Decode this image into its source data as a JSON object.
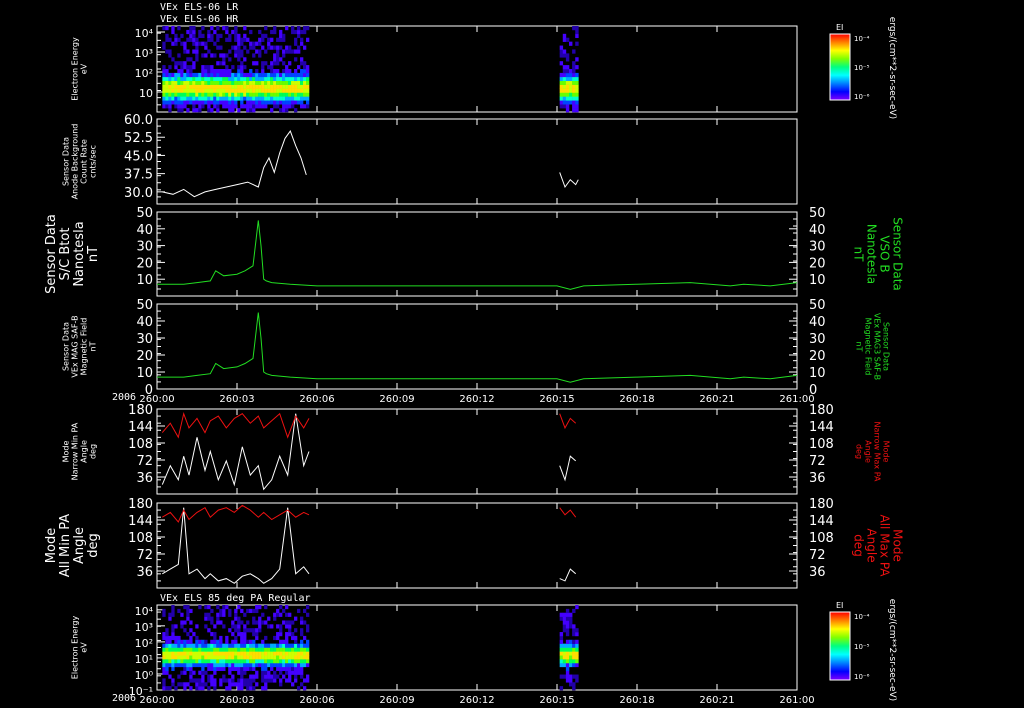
{
  "header": {
    "line1": "VEx ELS-06 LR",
    "line2": "VEx ELS-06 HR",
    "bottom_title": "VEx ELS 85 deg PA Regular",
    "year_mid": "2006",
    "year_bottom": "2006"
  },
  "colorbar": {
    "label": "EI",
    "units": "ergs/(cm**2-sr-sec-eV)",
    "ticks": [
      "10⁻⁴",
      "10⁻⁵",
      "10⁻⁶"
    ],
    "colors": [
      "#ff0000",
      "#ff8000",
      "#ffff00",
      "#80ff00",
      "#00ff80",
      "#00ffff",
      "#0080ff",
      "#0000ff",
      "#8000ff"
    ]
  },
  "colors": {
    "frame": "#ffffff",
    "green": "#22dd22",
    "red": "#ee1111",
    "white": "#ffffff"
  },
  "chart_data": {
    "type": "line",
    "x_tick_labels": [
      "260:00",
      "260:03",
      "260:06",
      "260:09",
      "260:12",
      "260:15",
      "260:18",
      "260:21",
      "261:00"
    ],
    "xlim_hours": [
      0,
      24
    ],
    "panels": [
      {
        "id": "els-spectrogram-top",
        "type": "heatmap",
        "ylabel_lines": [
          "Electron Energy",
          "eV"
        ],
        "y_tick_labels": [
          "10⁴",
          "10³",
          "10²",
          "10"
        ],
        "ylim_log10": [
          0,
          4.3
        ],
        "data_intervals_hours": [
          [
            0.2,
            5.7
          ],
          [
            15.1,
            15.8
          ]
        ]
      },
      {
        "id": "anode-background",
        "ylabel_lines": [
          "Sensor Data",
          "Anode Background",
          "Count Rate",
          "cnts/sec"
        ],
        "y_tick_labels": [
          "60.0",
          "52.5",
          "45.0",
          "37.5",
          "30.0"
        ],
        "ylim": [
          25,
          60
        ],
        "series": [
          {
            "color": "white",
            "x": [
              0.2,
              0.6,
              1.0,
              1.4,
              1.8,
              2.2,
              2.6,
              3.0,
              3.4,
              3.8,
              4.0,
              4.2,
              4.4,
              4.6,
              4.8,
              5.0,
              5.2,
              5.4,
              5.6,
              15.1,
              15.3,
              15.5,
              15.7,
              15.8
            ],
            "y": [
              30,
              29,
              31,
              28,
              30,
              31,
              32,
              33,
              34,
              32,
              40,
              44,
              38,
              46,
              52,
              55,
              49,
              44,
              37,
              38,
              32,
              35,
              33,
              35
            ]
          }
        ]
      },
      {
        "id": "sc-bmag",
        "ylabel_lines": [
          "Sensor Data",
          "S/C Btot",
          "Nanotesla",
          "nT"
        ],
        "ylabel_right_lines": [
          "Sensor Data",
          "VSO B",
          "Nanotesla",
          "nT"
        ],
        "y_tick_labels": [
          "50",
          "40",
          "30",
          "20",
          "10"
        ],
        "ylim": [
          0,
          50
        ],
        "series": [
          {
            "color": "green",
            "x": [
              0,
              1,
              1.5,
              2,
              2.2,
              2.5,
              3,
              3.3,
              3.6,
              3.8,
              3.9,
              4.0,
              4.1,
              4.3,
              5,
              6,
              8,
              10,
              12,
              14,
              15,
              15.5,
              16,
              18,
              20,
              21.5,
              22,
              23,
              24
            ],
            "y": [
              7,
              7,
              8,
              9,
              15,
              12,
              13,
              15,
              18,
              45,
              30,
              10,
              9,
              8,
              7,
              6,
              6,
              6,
              6,
              6,
              6,
              4,
              6,
              7,
              8,
              6,
              7,
              6,
              8
            ]
          }
        ]
      },
      {
        "id": "mag-field",
        "ylabel_lines": [
          "Sensor Data",
          "VEx MAG SAF-B",
          "Magnetic Field",
          "nT"
        ],
        "ylabel_right_lines": [
          "Sensor Data",
          "VEx MAG3 SAF-B",
          "Magnetic Field",
          "nT"
        ],
        "y_tick_labels": [
          "50",
          "40",
          "30",
          "20",
          "10",
          "0"
        ],
        "ylim": [
          0,
          50
        ],
        "series": [
          {
            "color": "green",
            "x": [
              0,
              1,
              1.5,
              2,
              2.2,
              2.5,
              3,
              3.3,
              3.6,
              3.8,
              3.9,
              4.0,
              4.1,
              4.3,
              5,
              6,
              8,
              10,
              12,
              14,
              15,
              15.5,
              16,
              18,
              20,
              21.5,
              22,
              23,
              24
            ],
            "y": [
              7,
              7,
              8,
              9,
              15,
              12,
              13,
              15,
              18,
              45,
              30,
              10,
              9,
              8,
              7,
              6,
              6,
              6,
              6,
              6,
              6,
              4,
              6,
              7,
              8,
              6,
              7,
              6,
              8
            ]
          }
        ]
      },
      {
        "id": "narrow-pa",
        "ylabel_lines": [
          "Mode",
          "Narrow Min PA",
          "Angle",
          "deg"
        ],
        "ylabel_right_lines": [
          "Mode",
          "Narrow Max PA",
          "Angle",
          "deg"
        ],
        "y_tick_labels": [
          "180",
          "144",
          "108",
          "72",
          "36"
        ],
        "ylim": [
          0,
          180
        ],
        "series": [
          {
            "color": "white",
            "x": [
              0.2,
              0.5,
              0.8,
              1.0,
              1.2,
              1.5,
              1.8,
              2.0,
              2.3,
              2.6,
              2.9,
              3.2,
              3.5,
              3.8,
              4.0,
              4.3,
              4.6,
              4.9,
              5.2,
              5.5,
              5.7,
              15.1,
              15.3,
              15.5,
              15.7
            ],
            "y": [
              20,
              60,
              30,
              80,
              40,
              120,
              50,
              90,
              30,
              70,
              20,
              100,
              40,
              60,
              10,
              30,
              80,
              40,
              170,
              60,
              90,
              60,
              30,
              80,
              70
            ]
          },
          {
            "color": "red",
            "x": [
              0.2,
              0.5,
              0.8,
              1.0,
              1.2,
              1.5,
              1.8,
              2.0,
              2.3,
              2.6,
              2.9,
              3.2,
              3.5,
              3.8,
              4.0,
              4.3,
              4.6,
              4.9,
              5.2,
              5.5,
              5.7,
              15.1,
              15.3,
              15.5,
              15.7
            ],
            "y": [
              130,
              150,
              120,
              170,
              140,
              160,
              130,
              155,
              165,
              140,
              160,
              170,
              150,
              165,
              140,
              155,
              170,
              120,
              165,
              140,
              160,
              170,
              140,
              160,
              150
            ]
          }
        ]
      },
      {
        "id": "all-pa",
        "ylabel_lines": [
          "Mode",
          "All Min PA",
          "Angle",
          "deg"
        ],
        "ylabel_right_lines": [
          "Mode",
          "All Max PA",
          "Angle",
          "deg"
        ],
        "y_tick_labels": [
          "180",
          "144",
          "108",
          "72",
          "36"
        ],
        "ylim": [
          0,
          180
        ],
        "series": [
          {
            "color": "white",
            "x": [
              0.2,
              0.5,
              0.8,
              1.0,
              1.2,
              1.5,
              1.8,
              2.0,
              2.3,
              2.6,
              2.9,
              3.2,
              3.5,
              3.8,
              4.0,
              4.3,
              4.6,
              4.9,
              5.2,
              5.5,
              5.7,
              15.1,
              15.3,
              15.5,
              15.7
            ],
            "y": [
              30,
              40,
              50,
              170,
              30,
              40,
              20,
              30,
              15,
              20,
              10,
              25,
              30,
              20,
              10,
              20,
              40,
              170,
              30,
              45,
              30,
              20,
              15,
              40,
              30
            ]
          },
          {
            "color": "red",
            "x": [
              0.2,
              0.5,
              0.8,
              1.0,
              1.2,
              1.5,
              1.8,
              2.0,
              2.3,
              2.6,
              2.9,
              3.2,
              3.5,
              3.8,
              4.0,
              4.3,
              4.6,
              4.9,
              5.2,
              5.5,
              5.7,
              15.1,
              15.3,
              15.5,
              15.7
            ],
            "y": [
              150,
              160,
              140,
              165,
              145,
              160,
              170,
              150,
              165,
              170,
              160,
              175,
              165,
              150,
              160,
              145,
              155,
              165,
              150,
              160,
              155,
              170,
              155,
              165,
              150
            ]
          }
        ]
      },
      {
        "id": "els-spectrogram-bottom",
        "type": "heatmap",
        "ylabel_lines": [
          "Electron Energy",
          "eV"
        ],
        "y_tick_labels": [
          "10⁴",
          "10³",
          "10²",
          "10¹",
          "10⁰",
          "10⁻¹"
        ],
        "ylim_log10": [
          -1,
          4.3
        ],
        "data_intervals_hours": [
          [
            0.2,
            5.7
          ],
          [
            15.1,
            15.8
          ]
        ]
      }
    ]
  }
}
